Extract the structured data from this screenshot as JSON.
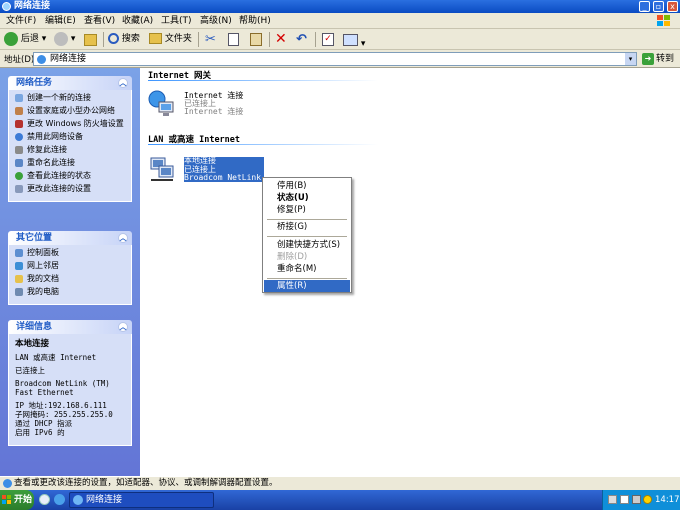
{
  "window": {
    "title": "网络连接"
  },
  "menu": [
    "文件(F)",
    "编辑(E)",
    "查看(V)",
    "收藏(A)",
    "工具(T)",
    "高级(N)",
    "帮助(H)"
  ],
  "toolbar": {
    "back": "后退",
    "search": "搜索",
    "folders": "文件夹"
  },
  "address": {
    "label": "地址(D)",
    "value": "网络连接",
    "go": "转到"
  },
  "tasks": {
    "title": "网络任务",
    "items": [
      "创建一个新的连接",
      "设置家庭或小型办公网络",
      "更改 Windows 防火墙设置",
      "禁用此网络设备",
      "修复此连接",
      "重命名此连接",
      "查看此连接的状态",
      "更改此连接的设置"
    ]
  },
  "other": {
    "title": "其它位置",
    "items": [
      "控制面板",
      "网上邻居",
      "我的文档",
      "我的电脑"
    ]
  },
  "details": {
    "title": "详细信息",
    "name": "本地连接",
    "lines": [
      "LAN 或高速 Internet",
      "已连接上",
      "Broadcom NetLink (TM) Fast Ethernet",
      "IP 地址:192.168.6.111",
      "子网掩码: 255.255.255.0",
      "通过 DHCP 指派",
      "启用 IPv6 的"
    ]
  },
  "main": {
    "sections": [
      {
        "title": "Internet 网关",
        "conn": {
          "name": "Internet 连接",
          "status": "已连接上",
          "device": "Internet 连接"
        }
      },
      {
        "title": "LAN 或高速 Internet",
        "conn": {
          "name": "本地连接",
          "status": "已连接上",
          "device": "Broadcom NetLink ..."
        }
      }
    ]
  },
  "context_menu": {
    "items": [
      "停用(B)",
      "状态(U)",
      "修复(P)",
      "桥接(G)",
      "创建快捷方式(S)",
      "删除(D)",
      "重命名(M)",
      "属性(R)"
    ],
    "disabled_index": 5,
    "highlight_index": 7
  },
  "status": "查看或更改该连接的设置，如适配器、协议、或调制解调器配置设置。",
  "taskbar": {
    "start": "开始",
    "item": "网络连接",
    "clock": "14:17"
  },
  "colors": {
    "selection": "#316ac5",
    "title": "#0a4bc2",
    "panel": "#d6dff7"
  }
}
